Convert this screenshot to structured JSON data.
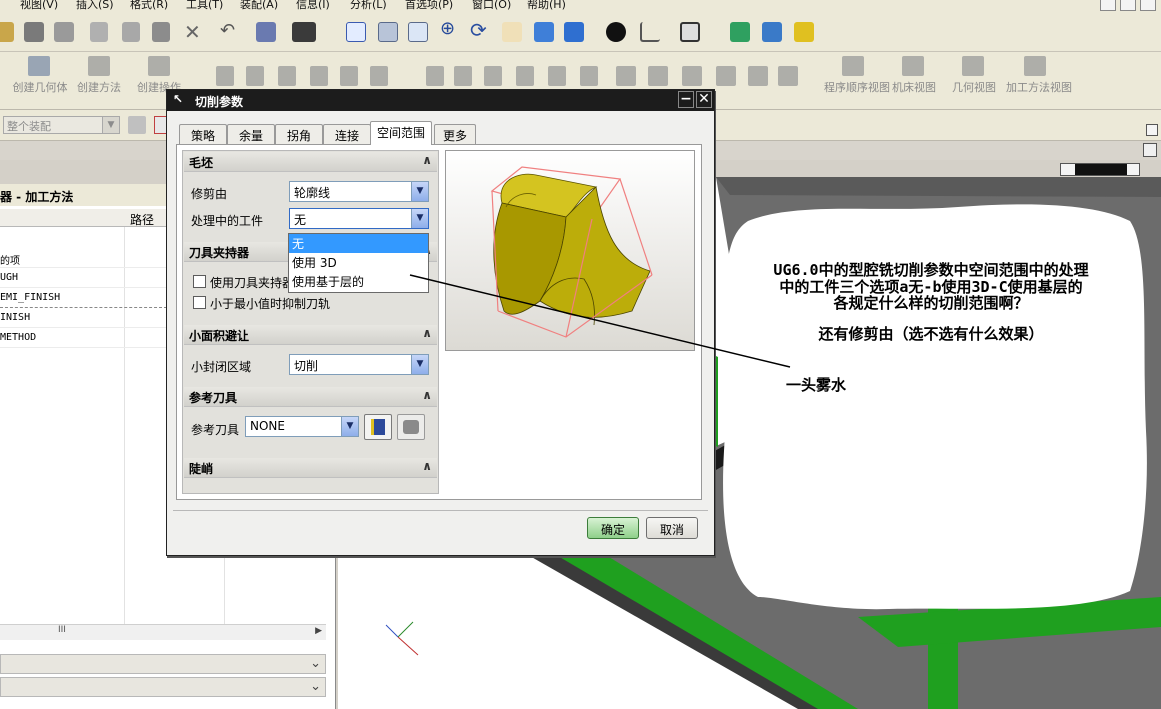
{
  "menu": [
    "视图(V)",
    "插入(S)",
    "格式(R)",
    "工具(T)",
    "装配(A)",
    "信息(I)",
    "分析(L)",
    "首选项(P)",
    "窗口(O)",
    "帮助(H)"
  ],
  "toolbar2": {
    "create_geometry": "创建几何体",
    "create_method": "创建方法",
    "create_operation": "创建操作",
    "program_order_view": "程序顺序视图",
    "machine_view": "机床视图",
    "geometry_view": "几何视图",
    "method_view": "加工方法视图"
  },
  "assembly_filter": "整个装配",
  "navigator": {
    "title": "器 - 加工方法",
    "column_path": "路径",
    "rows": [
      "的项",
      "UGH",
      "EMI_FINISH",
      "INISH",
      "METHOD"
    ],
    "hscroll_mark": "III"
  },
  "dialog": {
    "title": "切削参数",
    "tabs": [
      "策略",
      "余量",
      "拐角",
      "连接",
      "空间范围",
      "更多"
    ],
    "selected_tab": "空间范围",
    "sections": {
      "blank": "毛坯",
      "tool_holder": "刀具夹持器",
      "small_area": "小面积避让",
      "ref_tool": "参考刀具",
      "steep": "陡峭"
    },
    "trim_by_label": "修剪由",
    "trim_by_value": "轮廓线",
    "ipw_label": "处理中的工件",
    "ipw_value": "无",
    "ipw_options": [
      "无",
      "使用 3D",
      "使用基于层的"
    ],
    "ipw_selected": "无",
    "use_tool_holder_label": "使用刀具夹持器",
    "use_tool_holder_checked": false,
    "suppress_min_label": "小于最小值时抑制刀轨",
    "suppress_min_checked": false,
    "small_closed_label": "小封闭区域",
    "small_closed_value": "切削",
    "ref_tool_label": "参考刀具",
    "ref_tool_value": "NONE",
    "ok": "确定",
    "cancel": "取消"
  },
  "annotation": {
    "line1": "UG6.0中的型腔铣切削参数中空间范围中的处理",
    "line2": "中的工件三个选项a无-b使用3D-C使用基层的",
    "line3": "各规定什么样的切削范围啊？",
    "line4": "还有修剪由（选不选有什么效果）",
    "pointer_label": "一头雾水"
  },
  "colors": {
    "part_fill": "#b8a800",
    "bounds_box": "#f08080",
    "part_green": "#1fa01f",
    "part_gray": "#6e6e6e",
    "dialog_title_bg": "#1c1c1c",
    "selection": "#3399ff"
  },
  "icons": [
    "open-icon",
    "save-icon",
    "print-icon",
    "cut-icon",
    "copy-icon",
    "paste-icon",
    "delete-icon",
    "undo-icon",
    "info-icon",
    "display-icon",
    "fit-icon",
    "zoom-icon",
    "rotate-icon",
    "pan-icon",
    "render-icon",
    "triad-icon"
  ]
}
